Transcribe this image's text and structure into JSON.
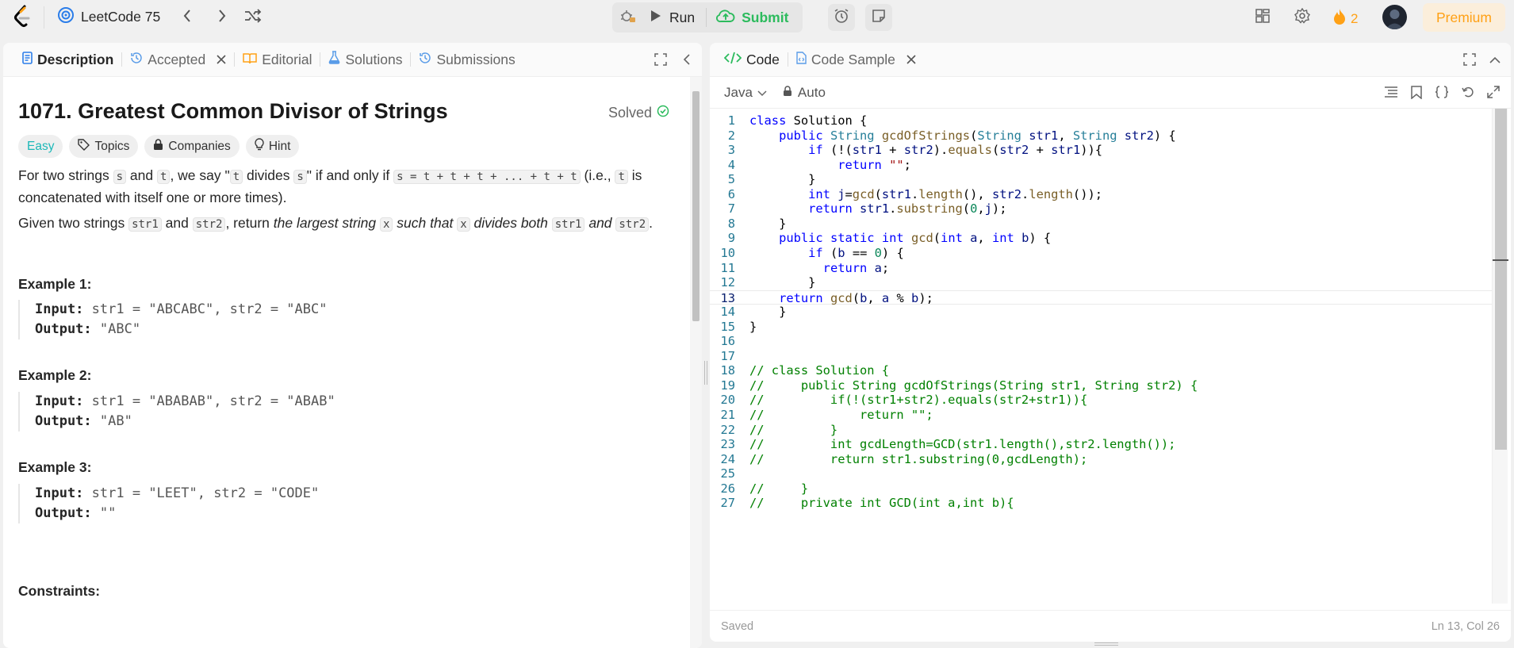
{
  "topbar": {
    "list_name": "LeetCode 75",
    "run_label": "Run",
    "submit_label": "Submit",
    "streak_count": "2",
    "premium_label": "Premium"
  },
  "left_tabs": [
    {
      "label": "Description",
      "icon": "document-icon"
    },
    {
      "label": "Accepted",
      "icon": "history-icon"
    },
    {
      "label": "Editorial",
      "icon": "book-icon"
    },
    {
      "label": "Solutions",
      "icon": "flask-icon"
    },
    {
      "label": "Submissions",
      "icon": "history-icon"
    }
  ],
  "problem": {
    "title": "1071. Greatest Common Divisor of Strings",
    "status": "Solved",
    "difficulty": "Easy",
    "chips": [
      "Topics",
      "Companies",
      "Hint"
    ],
    "p1": {
      "a": "For two strings ",
      "s": "s",
      "b": " and ",
      "t": "t",
      "c": ", we say \"",
      "t2": "t",
      "d": " divides ",
      "s2": "s",
      "e": "\" if and only if ",
      "expr": "s = t + t + t + ... + t + t",
      "f": " (i.e., ",
      "t3": "t",
      "g": " is",
      "line2": "concatenated with itself one or more times)."
    },
    "p2": {
      "a": "Given two strings ",
      "str1": "str1",
      "b": " and ",
      "str2": "str2",
      "c": ", return ",
      "d": "the largest string ",
      "x": "x",
      "e": " such that ",
      "x2": "x",
      "f": " divides both ",
      "str1b": "str1",
      "g": " and ",
      "str2b": "str2",
      "h": "."
    },
    "examples": [
      {
        "heading": "Example 1:",
        "input": "str1 = \"ABCABC\", str2 = \"ABC\"",
        "output": "\"ABC\""
      },
      {
        "heading": "Example 2:",
        "input": "str1 = \"ABABAB\", str2 = \"ABAB\"",
        "output": "\"AB\""
      },
      {
        "heading": "Example 3:",
        "input": "str1 = \"LEET\", str2 = \"CODE\"",
        "output": "\"\""
      }
    ],
    "input_label": "Input:",
    "output_label": "Output:",
    "constraints_heading": "Constraints:"
  },
  "right_tabs": [
    {
      "label": "Code",
      "icon": "code-icon"
    },
    {
      "label": "Code Sample",
      "icon": "file-code-icon"
    }
  ],
  "editor": {
    "language": "Java",
    "mode": "Auto",
    "status_left": "Saved",
    "status_right": "Ln 13, Col 26",
    "current_line": 13
  },
  "code_lines": [
    "class Solution {",
    "    public String gcdOfStrings(String str1, String str2) {",
    "        if (!(str1 + str2).equals(str2 + str1)){",
    "            return \"\";",
    "        }",
    "        int j=gcd(str1.length(), str2.length());",
    "        return str1.substring(0,j);",
    "    }",
    "    public static int gcd(int a, int b) {",
    "        if (b == 0) {",
    "          return a;",
    "        }",
    "    return gcd(b, a % b);",
    "    }",
    "}",
    "",
    "",
    "// class Solution {",
    "//     public String gcdOfStrings(String str1, String str2) {",
    "//         if(!(str1+str2).equals(str2+str1)){",
    "//             return \"\";",
    "//         }",
    "//         int gcdLength=GCD(str1.length(),str2.length());",
    "//         return str1.substring(0,gcdLength);",
    "",
    "//     }",
    "//     private int GCD(int a,int b){"
  ]
}
